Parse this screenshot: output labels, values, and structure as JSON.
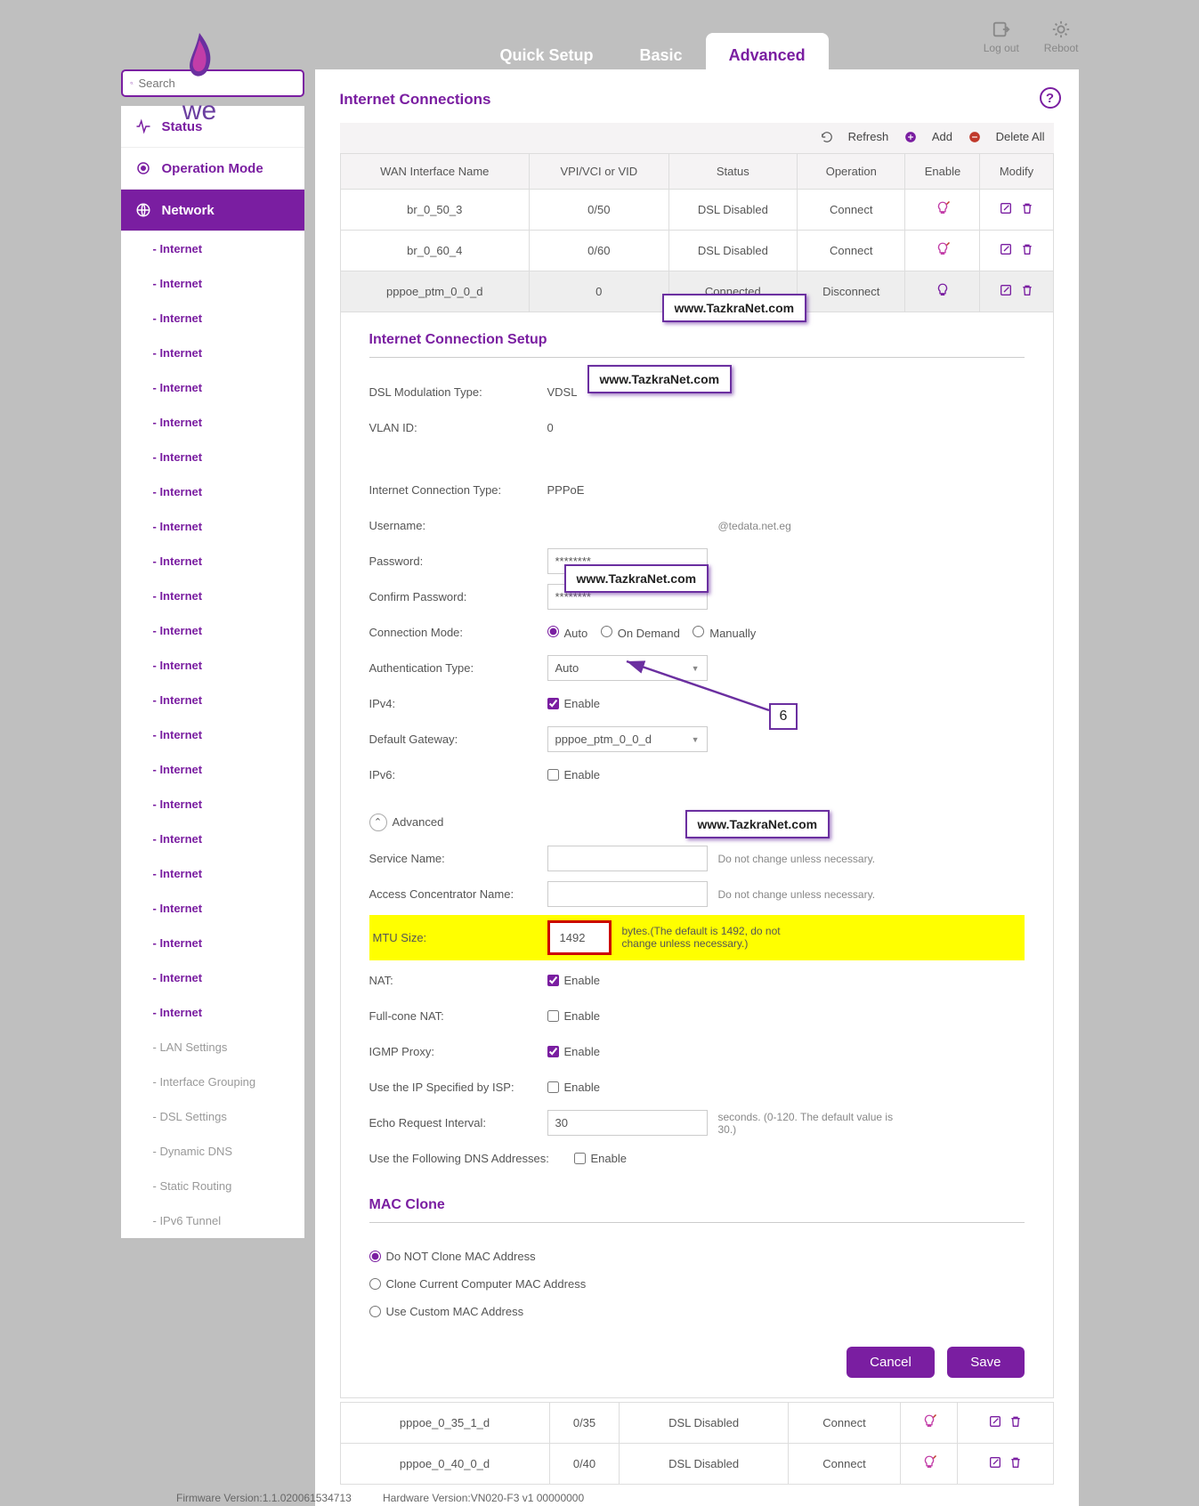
{
  "brand": {
    "text": "we"
  },
  "top_tabs": {
    "quick": "Quick Setup",
    "basic": "Basic",
    "advanced": "Advanced"
  },
  "top_actions": {
    "logout": "Log out",
    "reboot": "Reboot"
  },
  "search": {
    "placeholder": "Search"
  },
  "nav": {
    "status": "Status",
    "operation": "Operation Mode",
    "network": "Network",
    "subs": {
      "internet": "- Internet",
      "lan": "- LAN Settings",
      "ifgroup": "- Interface Grouping",
      "dsl": "- DSL Settings",
      "ddns": "- Dynamic DNS",
      "static": "- Static Routing",
      "ipv6t": "- IPv6 Tunnel"
    }
  },
  "page": {
    "title": "Internet Connections",
    "actions": {
      "refresh": "Refresh",
      "add": "Add",
      "deleteall": "Delete All"
    }
  },
  "table": {
    "headers": {
      "wan": "WAN Interface Name",
      "vpi": "VPI/VCI or VID",
      "status": "Status",
      "op": "Operation",
      "enable": "Enable",
      "modify": "Modify"
    },
    "rows": [
      {
        "wan": "br_0_50_3",
        "vpi": "0/50",
        "status": "DSL Disabled",
        "op": "Connect",
        "op_class": "op-connect"
      },
      {
        "wan": "br_0_60_4",
        "vpi": "0/60",
        "status": "DSL Disabled",
        "op": "Connect",
        "op_class": "op-connect"
      },
      {
        "wan": "pppoe_ptm_0_0_d",
        "vpi": "0",
        "status": "Connected",
        "op": "Disconnect",
        "op_class": "op-disconnect",
        "selected": true
      }
    ],
    "footer_rows": [
      {
        "wan": "pppoe_0_35_1_d",
        "vpi": "0/35",
        "status": "DSL Disabled",
        "op": "Connect",
        "op_class": "op-connect"
      },
      {
        "wan": "pppoe_0_40_0_d",
        "vpi": "0/40",
        "status": "DSL Disabled",
        "op": "Connect",
        "op_class": "op-connect"
      }
    ]
  },
  "setup": {
    "title": "Internet Connection Setup",
    "dsl_type_lbl": "DSL Modulation Type:",
    "dsl_type_val": "VDSL",
    "vlan_lbl": "VLAN ID:",
    "vlan_val": "0",
    "conn_type_lbl": "Internet Connection Type:",
    "conn_type_val": "PPPoE",
    "user_lbl": "Username:",
    "user_suffix": "@tedata.net.eg",
    "pass_lbl": "Password:",
    "pass_val": "********",
    "cpass_lbl": "Confirm Password:",
    "cpass_val": "********",
    "connmode_lbl": "Connection Mode:",
    "connmode_opts": {
      "auto": "Auto",
      "ondemand": "On Demand",
      "manual": "Manually"
    },
    "auth_lbl": "Authentication Type:",
    "auth_val": "Auto",
    "ipv4_lbl": "IPv4:",
    "enable_lbl": "Enable",
    "gw_lbl": "Default Gateway:",
    "gw_val": "pppoe_ptm_0_0_d",
    "ipv6_lbl": "IPv6:",
    "advanced_toggle": "Advanced",
    "svc_lbl": "Service Name:",
    "svc_hint": "Do not change unless necessary.",
    "ac_lbl": "Access Concentrator Name:",
    "ac_hint": "Do not change unless necessary.",
    "mtu_lbl": "MTU Size:",
    "mtu_val": "1492",
    "mtu_hint": "bytes.(The default is 1492, do not change unless necessary.)",
    "nat_lbl": "NAT:",
    "fcnat_lbl": "Full-cone NAT:",
    "igmp_lbl": "IGMP Proxy:",
    "ipisp_lbl": "Use the IP Specified by ISP:",
    "echo_lbl": "Echo Request Interval:",
    "echo_val": "30",
    "echo_hint": "seconds. (0-120. The default value is 30.)",
    "dns_lbl": "Use the Following DNS Addresses:"
  },
  "mac": {
    "title": "MAC Clone",
    "opt1": "Do NOT Clone MAC Address",
    "opt2": "Clone Current Computer MAC Address",
    "opt3": "Use Custom MAC Address"
  },
  "buttons": {
    "cancel": "Cancel",
    "save": "Save"
  },
  "watermark": "www.TazkraNet.com",
  "callout_num": "6",
  "firmware": "Firmware Version:1.1.020061534713",
  "hardware": "Hardware Version:VN020-F3 v1 00000000"
}
